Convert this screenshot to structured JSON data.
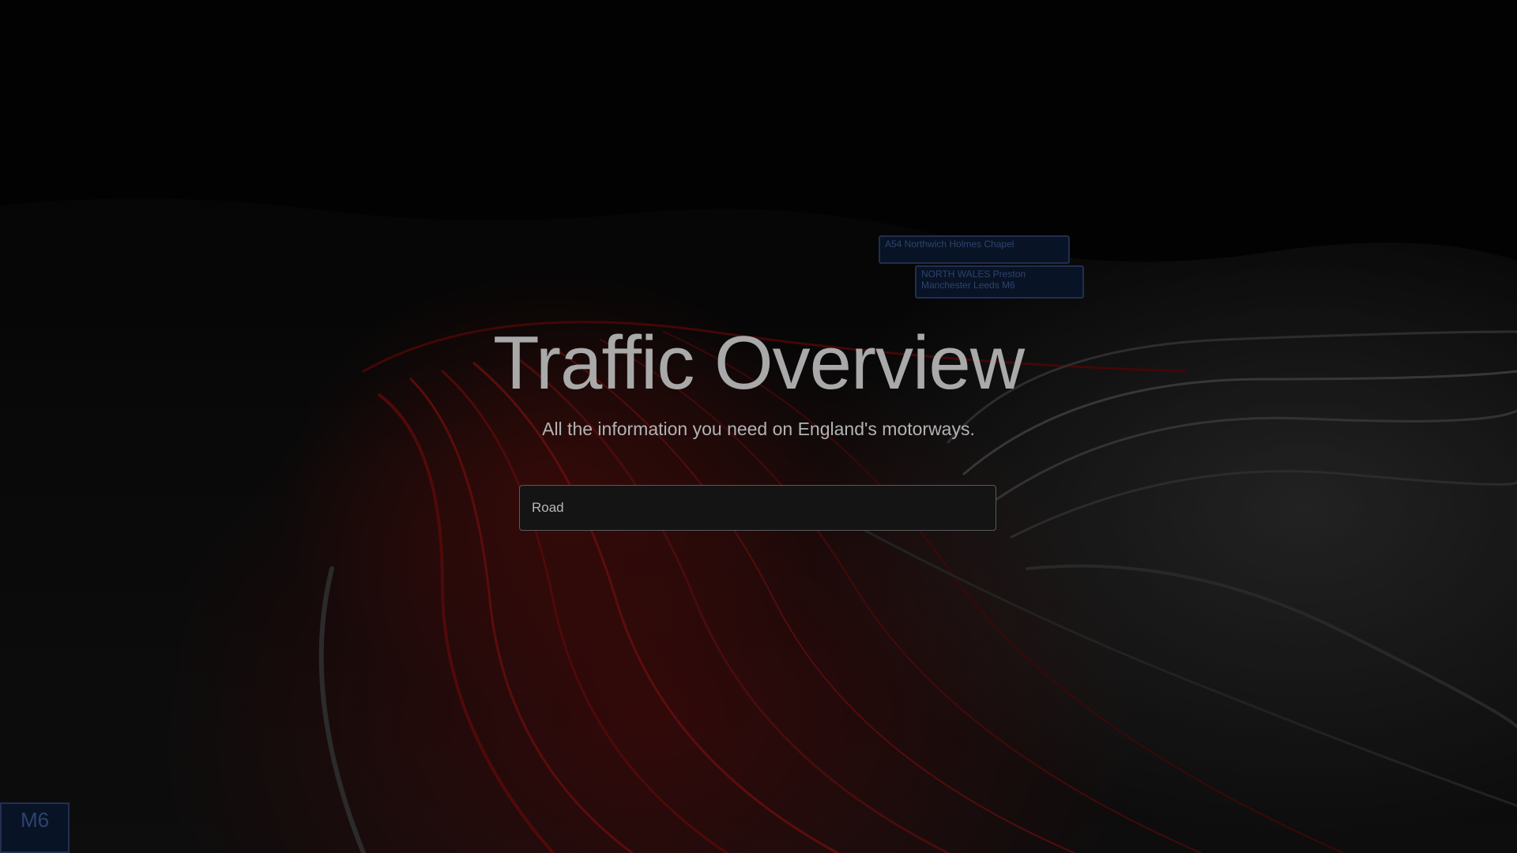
{
  "hero": {
    "title": "Traffic Overview",
    "subtitle": "All the information you need on England's motorways."
  },
  "search": {
    "placeholder": "Road",
    "value": ""
  },
  "background": {
    "signs": [
      "A54 Northwich Holmes Chapel",
      "NORTH WALES Preston Manchester Leeds M6",
      "M6"
    ]
  },
  "colors": {
    "title": "#a9a9a9",
    "subtitle": "#b3b3b3",
    "input_bg": "#141414",
    "input_border": "#5a5a5a"
  }
}
